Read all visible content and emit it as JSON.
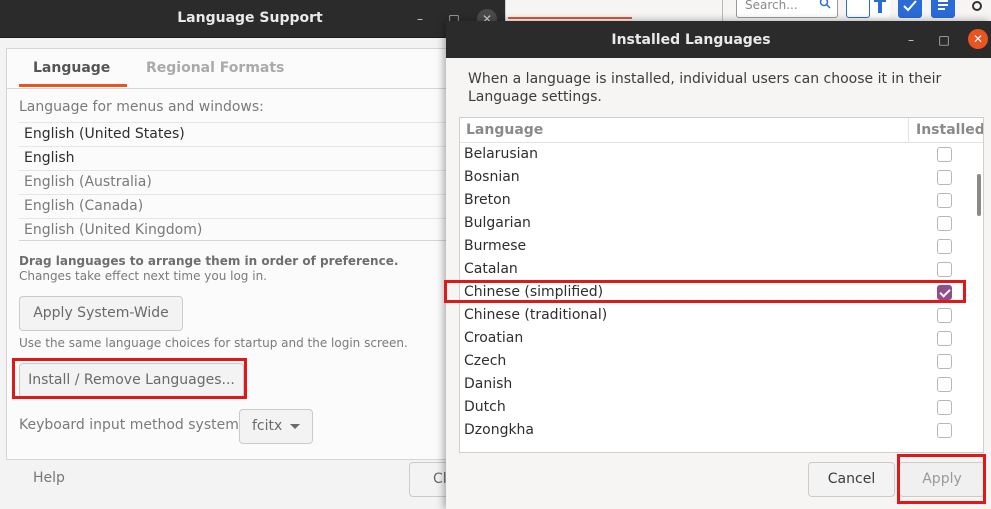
{
  "background_app": {
    "search_placeholder": "Search...",
    "accent": "#2a6bd6"
  },
  "language_support": {
    "title": "Language Support",
    "tabs": [
      {
        "label": "Language",
        "active": true
      },
      {
        "label": "Regional Formats",
        "active": false
      }
    ],
    "section_label": "Language for menus and windows:",
    "languages": [
      "English (United States)",
      "English",
      "English (Australia)",
      "English (Canada)",
      "English (United Kingdom)"
    ],
    "drag_hint": "Drag languages to arrange them in order of preference.",
    "effect_hint": "Changes take effect next time you log in.",
    "apply_system_wide_label": "Apply System-Wide",
    "startup_hint": "Use the same language choices for startup and the login screen.",
    "install_remove_label": "Install / Remove Languages...",
    "keyboard_label": "Keyboard input method system:",
    "keyboard_value": "fcitx",
    "help_label": "Help",
    "close_label_partial": "Cl"
  },
  "installed_languages": {
    "title": "Installed Languages",
    "description": "When a language is installed, individual users can choose it in their Language settings.",
    "columns": {
      "language": "Language",
      "installed": "Installed"
    },
    "rows": [
      {
        "name": "Belarusian",
        "installed": false
      },
      {
        "name": "Bosnian",
        "installed": false
      },
      {
        "name": "Breton",
        "installed": false
      },
      {
        "name": "Bulgarian",
        "installed": false
      },
      {
        "name": "Burmese",
        "installed": false
      },
      {
        "name": "Catalan",
        "installed": false
      },
      {
        "name": "Chinese (simplified)",
        "installed": true
      },
      {
        "name": "Chinese (traditional)",
        "installed": false
      },
      {
        "name": "Croatian",
        "installed": false
      },
      {
        "name": "Czech",
        "installed": false
      },
      {
        "name": "Danish",
        "installed": false
      },
      {
        "name": "Dutch",
        "installed": false
      },
      {
        "name": "Dzongkha",
        "installed": false
      }
    ],
    "cancel_label": "Cancel",
    "apply_label": "Apply",
    "checkbox_color": "#924d8b",
    "close_button_color": "#e95420"
  },
  "highlight_color": "#e01818"
}
